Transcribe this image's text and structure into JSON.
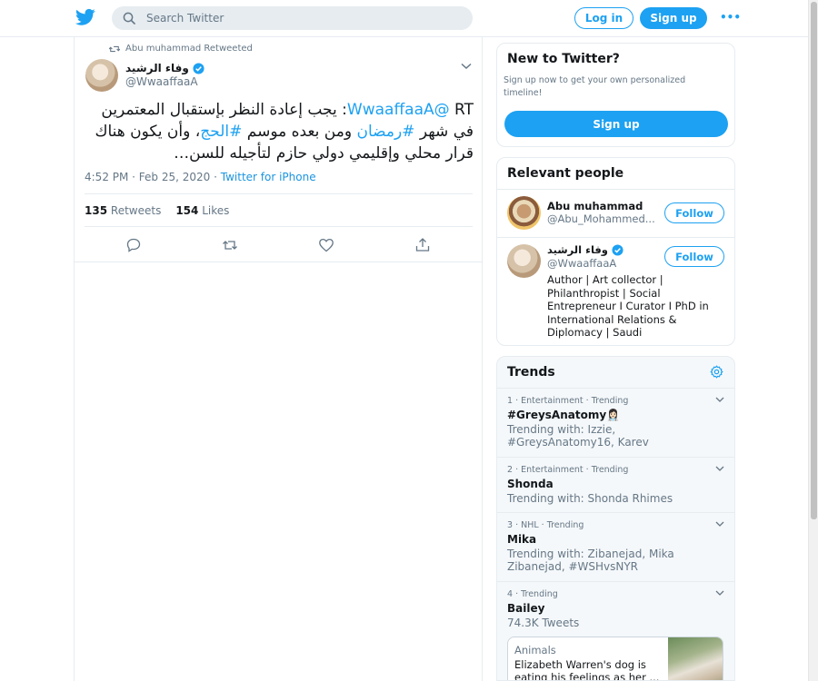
{
  "header": {
    "search_placeholder": "Search Twitter",
    "login_label": "Log in",
    "signup_label": "Sign up",
    "more_label": "•••",
    "logo_icon": "twitter-bird-icon"
  },
  "tweet": {
    "retweeted_by": "Abu  muhammad Retweeted",
    "author_name": "وفاء الرشيد",
    "author_handle": "@WwaaffaaA",
    "text_prefix": "RT ",
    "mention": "@WwaaffaaA",
    "text_part1": ": يجب إعادة النظر بإستقبال المعتمرين في شهر ",
    "hashtag1": "#رمضان",
    "text_part2": " ومن بعده موسم ",
    "hashtag2": "#الحج",
    "text_part3": "، وأن يكون هناك قرار محلي وإقليمي دولي حازم لتأجيله للسن…",
    "time": "4:52 PM · Feb 25, 2020 · ",
    "source": "Twitter for iPhone",
    "retweets_count": "135",
    "retweets_label": "Retweets",
    "likes_count": "154",
    "likes_label": "Likes"
  },
  "new_to_twitter": {
    "title": "New to Twitter?",
    "subtitle": "Sign up now to get your own personalized timeline!",
    "signup_label": "Sign up"
  },
  "relevant_people": {
    "title": "Relevant people",
    "people": [
      {
        "name": "Abu muhammad",
        "handle": "@Abu_Mohammed...",
        "follow_label": "Follow",
        "verified": false
      },
      {
        "name": "وفاء الرشيد",
        "handle": "@WwaaffaaA",
        "follow_label": "Follow",
        "verified": true,
        "bio": "Author | Art collector | Philanthropist | Social Entrepreneur I Curator I PhD in International Relations & Diplomacy | Saudi"
      }
    ]
  },
  "trends": {
    "title": "Trends",
    "items": [
      {
        "meta": "1 · Entertainment · Trending",
        "name": "#GreysAnatomy👩🏻‍⚕️",
        "sub": "Trending with: Izzie, #GreysAnatomy16, Karev"
      },
      {
        "meta": "2 · Entertainment · Trending",
        "name": "Shonda",
        "sub": "Trending with: Shonda Rhimes"
      },
      {
        "meta": "3 · NHL · Trending",
        "name": "Mika",
        "sub": "Trending with: Zibanejad, Mika Zibanejad, #WSHvsNYR"
      },
      {
        "meta": "4 · Trending",
        "name": "Bailey",
        "sub": "74.3K Tweets"
      }
    ],
    "news": {
      "category": "Animals",
      "title": "Elizabeth Warren's dog is eating his feelings as her ..."
    }
  },
  "colors": {
    "accent": "#1da1f2",
    "text": "#14171a",
    "muted": "#657786",
    "border": "#e6ecf0"
  }
}
